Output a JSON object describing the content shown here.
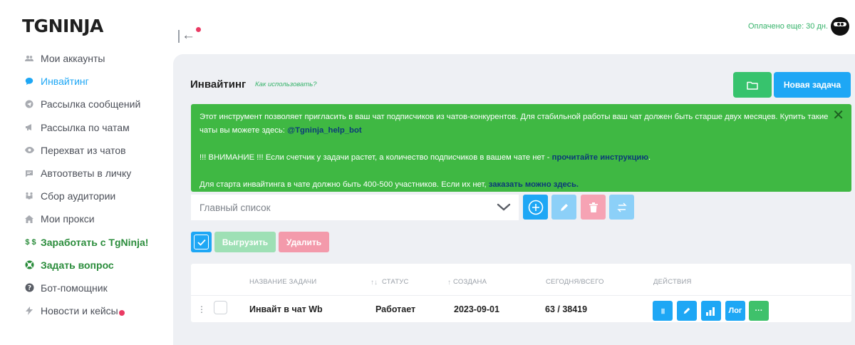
{
  "brand": {
    "logo_tg": "TG",
    "logo_ninja": "NINJA"
  },
  "sidebar": {
    "items": [
      {
        "label": "Мои аккаунты",
        "icon": "users-icon"
      },
      {
        "label": "Инвайтинг",
        "icon": "chat-bubble-icon",
        "active": true
      },
      {
        "label": "Рассылка сообщений",
        "icon": "send-icon"
      },
      {
        "label": "Рассылка по чатам",
        "icon": "megaphone-icon"
      },
      {
        "label": "Перехват из чатов",
        "icon": "eye-icon"
      },
      {
        "label": "Автоответы в личку",
        "icon": "message-icon"
      },
      {
        "label": "Сбор аудитории",
        "icon": "people-group-icon"
      },
      {
        "label": "Мои прокси",
        "icon": "house-icon"
      },
      {
        "label": "Заработать с TgNinja!",
        "icon": "dollar-icon",
        "icon_text": "$ $"
      },
      {
        "label": "Задать вопрос",
        "icon": "support-ring-icon"
      },
      {
        "label": "Бот-помощник",
        "icon": "question-icon"
      },
      {
        "label": "Новости и кейсы",
        "icon": "lightning-icon"
      }
    ]
  },
  "header": {
    "paid_text": "Оплачено еще: 30 дн."
  },
  "page": {
    "title": "Инвайтинг",
    "howto": "Как использовать?",
    "new_task": "Новая задача"
  },
  "alert": {
    "line1": "Этот инструмент позволяет пригласить в ваш чат подписчиков из чатов-конкурентов. Для стабильной работы ваш чат должен быть старше двух месяцев. Купить такие чаты вы можете здесь: ",
    "line1_link": "@Tgninja_help_bot",
    "line2": "!!! ВНИМАНИЕ !!! Если счетчик у задачи растет, а количество подписчиков в вашем чате нет - ",
    "line2_link": "прочитайте инструкцию",
    "line2_tail": ".",
    "line3": "Для старта инвайтинга в чате должно быть 400-500 участников. Если их нет, ",
    "line3_link": "заказать можно здесь."
  },
  "list": {
    "selected": "Главный список"
  },
  "bulk": {
    "export": "Выгрузить",
    "delete": "Удалить"
  },
  "table": {
    "headers": {
      "name": "НАЗВАНИЕ ЗАДАЧИ",
      "status": "СТАТУС",
      "created": "СОЗДАНА",
      "counts": "СЕГОДНЯ/ВСЕГО",
      "actions": "ДЕЙСТВИЯ"
    },
    "rows": [
      {
        "name": "Инвайт в чат Wb",
        "status": "Работает",
        "created": "2023-09-01",
        "counts": "63 / 38419",
        "pause": "॥",
        "log": "Лог",
        "more": "···"
      }
    ]
  },
  "colors": {
    "accent": "#1ea7f5",
    "success": "#3fb843",
    "danger": "#f39aab"
  }
}
